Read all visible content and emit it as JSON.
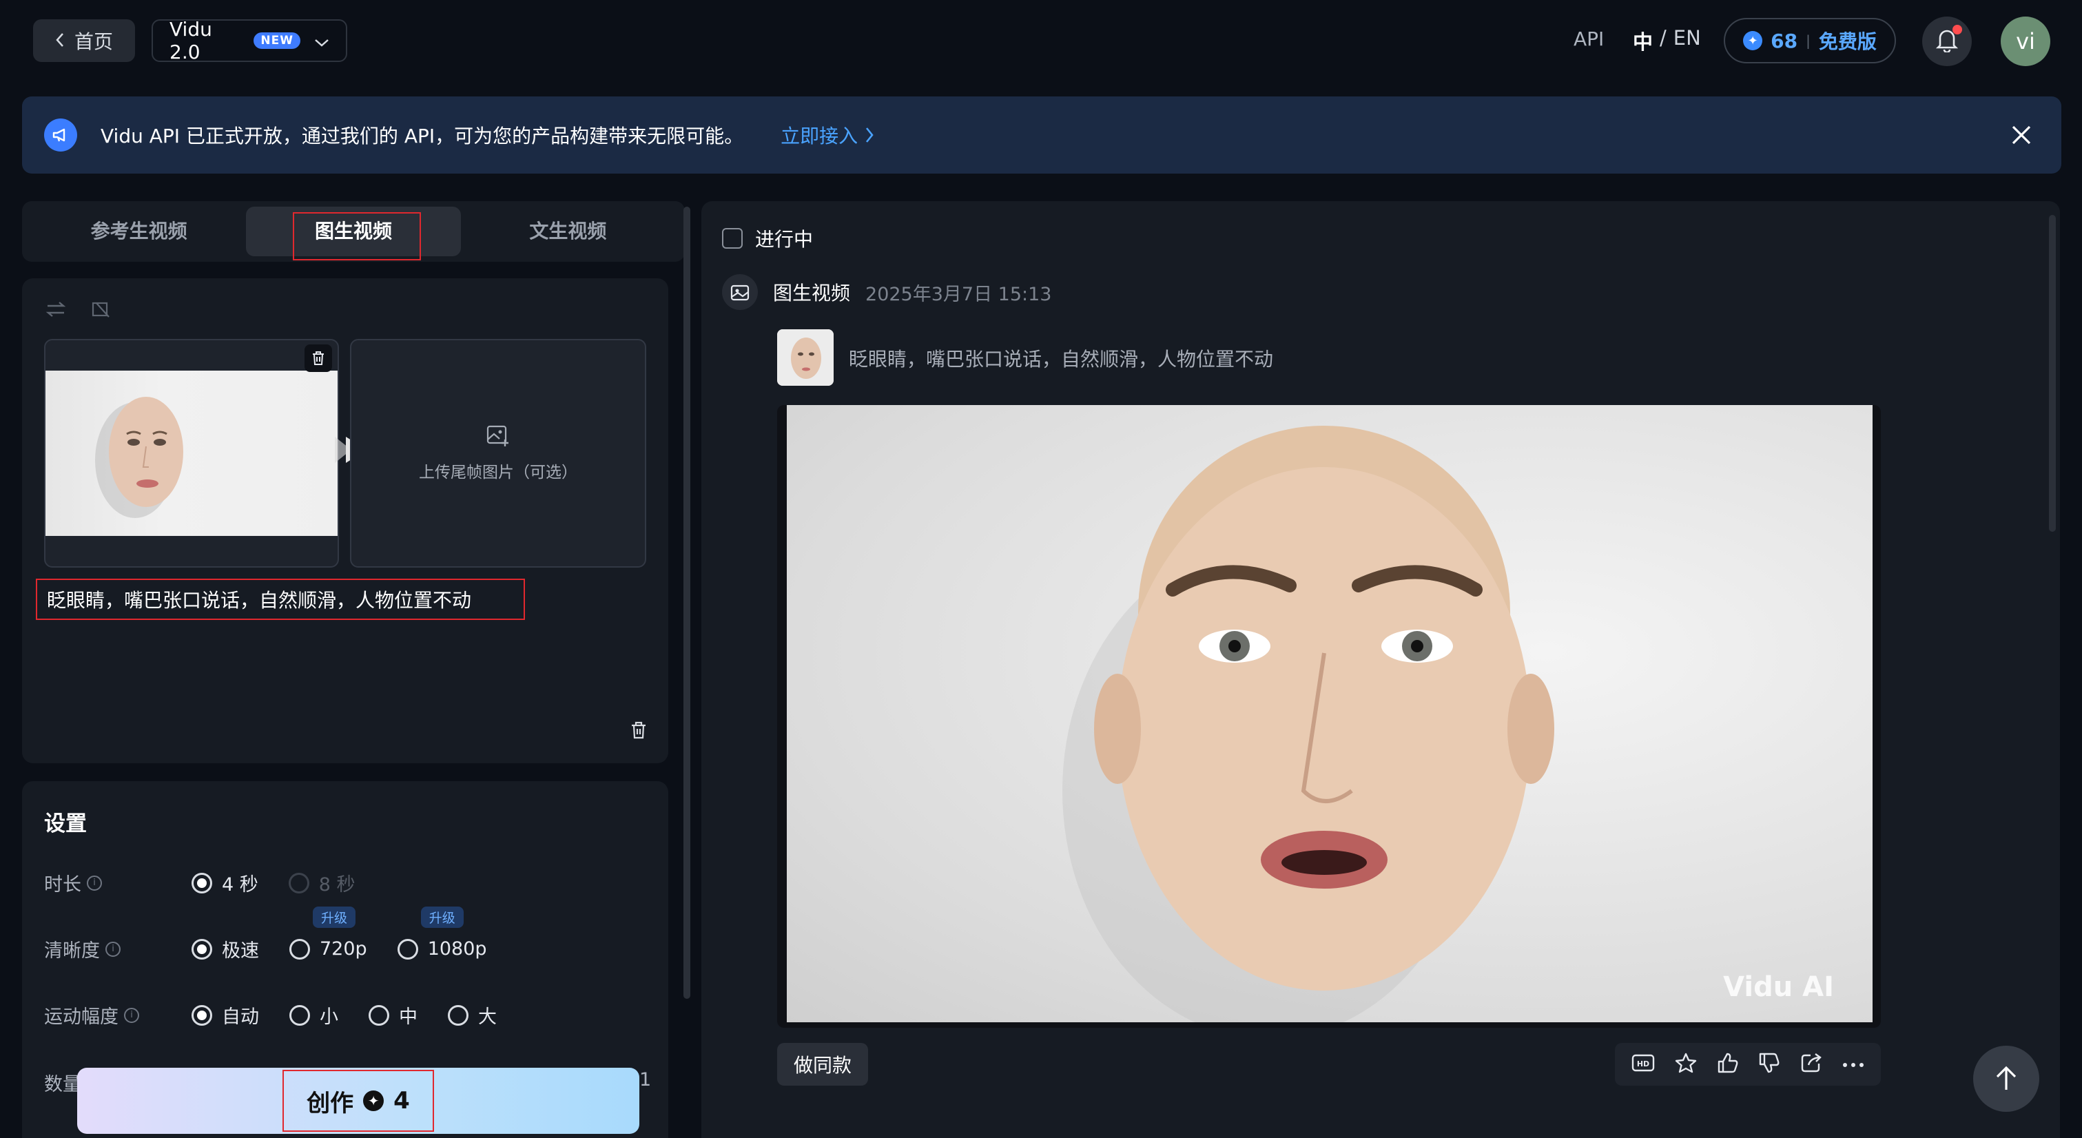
{
  "header": {
    "home_label": "首页",
    "model_name": "Vidu 2.0",
    "model_badge": "NEW",
    "api_label": "API",
    "lang_zh": "中",
    "lang_sep": "/",
    "lang_en": "EN",
    "credits": "68",
    "credits_sep": "|",
    "plan": "免费版",
    "avatar_text": "vi"
  },
  "banner": {
    "text": "Vidu API 已正式开放，通过我们的 API，可为您的产品构建带来无限可能。",
    "link": "立即接入"
  },
  "tabs": [
    {
      "label": "参考生视频"
    },
    {
      "label": "图生视频",
      "active": true
    },
    {
      "label": "文生视频"
    }
  ],
  "upload": {
    "end_frame_label": "上传尾帧图片（可选）",
    "prompt": "眨眼睛，嘴巴张口说话，自然顺滑，人物位置不动"
  },
  "settings": {
    "title": "设置",
    "duration": {
      "label": "时长",
      "options": [
        "4 秒",
        "8 秒"
      ],
      "selected": "4 秒"
    },
    "resolution": {
      "label": "清晰度",
      "options": [
        "极速",
        "720p",
        "1080p"
      ],
      "selected": "极速",
      "upgrade_label": "升级"
    },
    "motion": {
      "label": "运动幅度",
      "options": [
        "自动",
        "小",
        "中",
        "大"
      ],
      "selected": "自动"
    },
    "quantity_label": "数量",
    "quantity_value": "1"
  },
  "create_button": {
    "label": "创作",
    "cost": "4"
  },
  "results": {
    "in_progress_label": "进行中",
    "item": {
      "type": "图生视频",
      "date": "2025年3月7日 15:13",
      "prompt": "眨眼睛，嘴巴张口说话，自然顺滑，人物位置不动",
      "watermark": "Vidu AI",
      "same_style_button": "做同款"
    }
  },
  "colors": {
    "accent": "#3b8bff",
    "highlight": "#e0282e",
    "background": "#0b0f17",
    "panel": "#161b23"
  }
}
